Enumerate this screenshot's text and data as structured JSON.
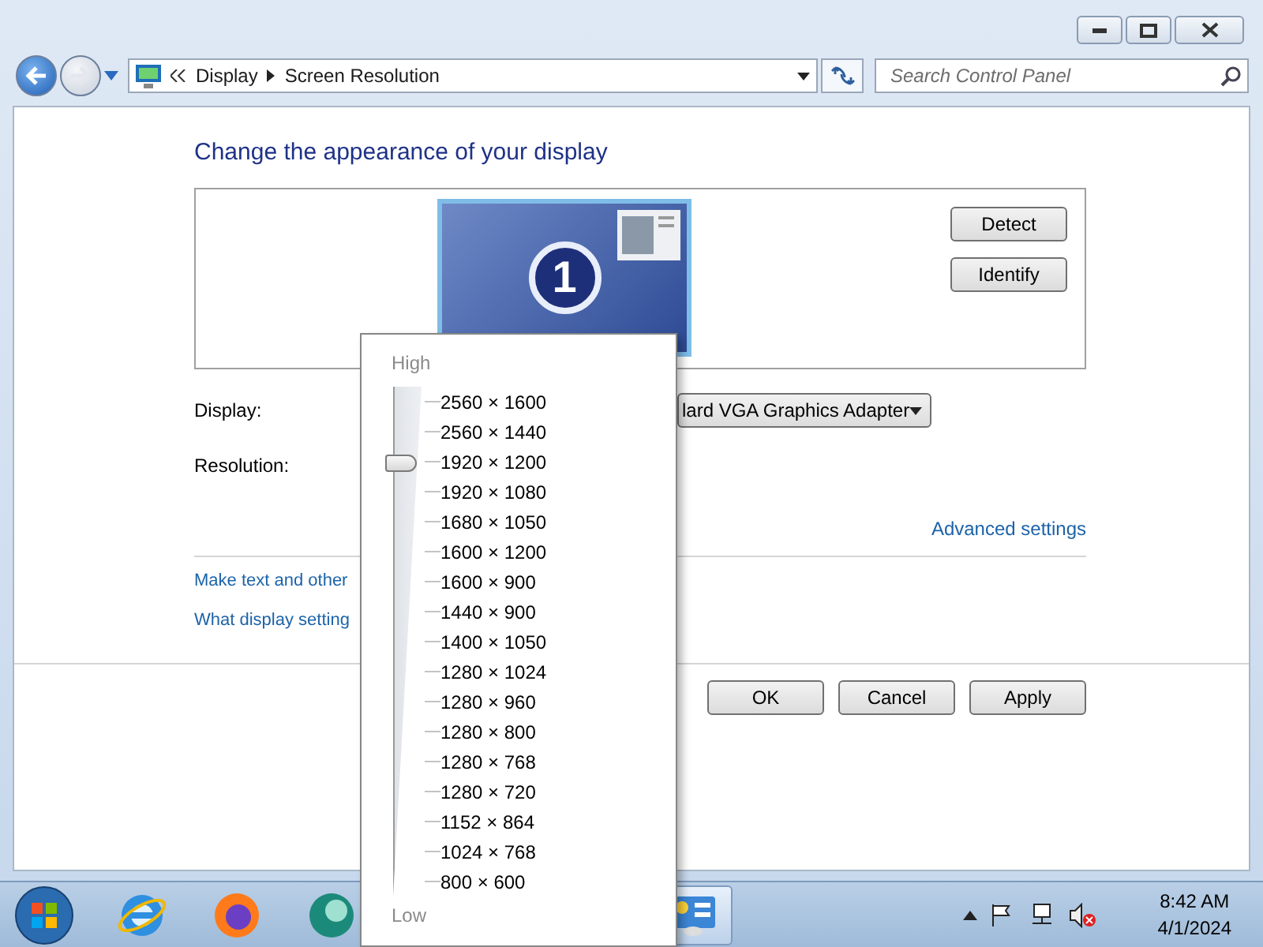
{
  "address_bar": {
    "breadcrumb": [
      "Display",
      "Screen Resolution"
    ]
  },
  "search": {
    "placeholder": "Search Control Panel"
  },
  "content": {
    "heading": "Change the appearance of your display",
    "monitor_number": "1",
    "side_buttons": [
      "Detect",
      "Identify"
    ],
    "display": {
      "label": "Display:",
      "value": "lard VGA Graphics Adapter"
    },
    "resolution": {
      "label": "Resolution:"
    },
    "advanced_link": "Advanced settings",
    "links": [
      "Make text and other",
      "What display setting"
    ],
    "dialog_buttons": [
      "OK",
      "Cancel",
      "Apply"
    ]
  },
  "resolution_popup": {
    "high_label": "High",
    "low_label": "Low",
    "level": 0.875,
    "options": [
      "2560 × 1600",
      "2560 × 1440",
      "1920 × 1200",
      "1920 × 1080",
      "1680 × 1050",
      "1600 × 1200",
      "1600 × 900",
      "1440 × 900",
      "1400 × 1050",
      "1280 × 1024",
      "1280 × 960",
      "1280 × 800",
      "1280 × 768",
      "1280 × 720",
      "1152 × 864",
      "1024 × 768",
      "800 × 600"
    ]
  },
  "taskbar": {
    "time": "8:42 AM",
    "date": "4/1/2024"
  }
}
